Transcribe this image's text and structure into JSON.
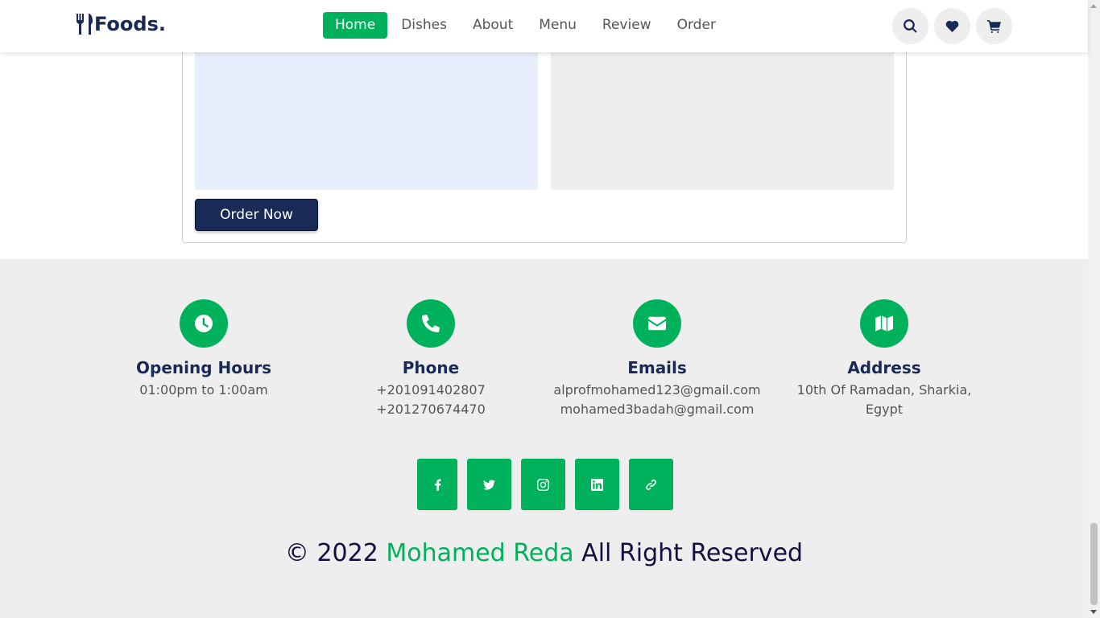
{
  "header": {
    "logo_text": "Foods.",
    "nav": [
      {
        "label": "Home",
        "active": true
      },
      {
        "label": "Dishes",
        "active": false
      },
      {
        "label": "About",
        "active": false
      },
      {
        "label": "Menu",
        "active": false
      },
      {
        "label": "Review",
        "active": false
      },
      {
        "label": "Order",
        "active": false
      }
    ],
    "icons": [
      "search-icon",
      "heart-icon",
      "cart-icon"
    ]
  },
  "order": {
    "button_label": "Order Now"
  },
  "footer": {
    "opening": {
      "icon": "clock-icon",
      "title": "Opening Hours",
      "lines": [
        "01:00pm to 1:00am"
      ]
    },
    "phone": {
      "icon": "phone-icon",
      "title": "Phone",
      "lines": [
        "+201091402807",
        "+201270674470"
      ]
    },
    "emails": {
      "icon": "envelope-icon",
      "title": "Emails",
      "lines": [
        "alprofmohamed123@gmail.com",
        "mohamed3badah@gmail.com"
      ]
    },
    "address": {
      "icon": "map-icon",
      "title": "Address",
      "lines": [
        "10th Of Ramadan, Sharkia,",
        "Egypt"
      ]
    }
  },
  "social": [
    "facebook-icon",
    "twitter-icon",
    "instagram-icon",
    "linkedin-icon",
    "link-icon"
  ],
  "copyright": {
    "prefix": "© 2022",
    "name": "Mohamed Reda",
    "suffix": "All Right Reserved"
  },
  "colors": {
    "accent": "#00b15c",
    "navy": "#192a56",
    "footer_bg": "#eeeeee"
  }
}
